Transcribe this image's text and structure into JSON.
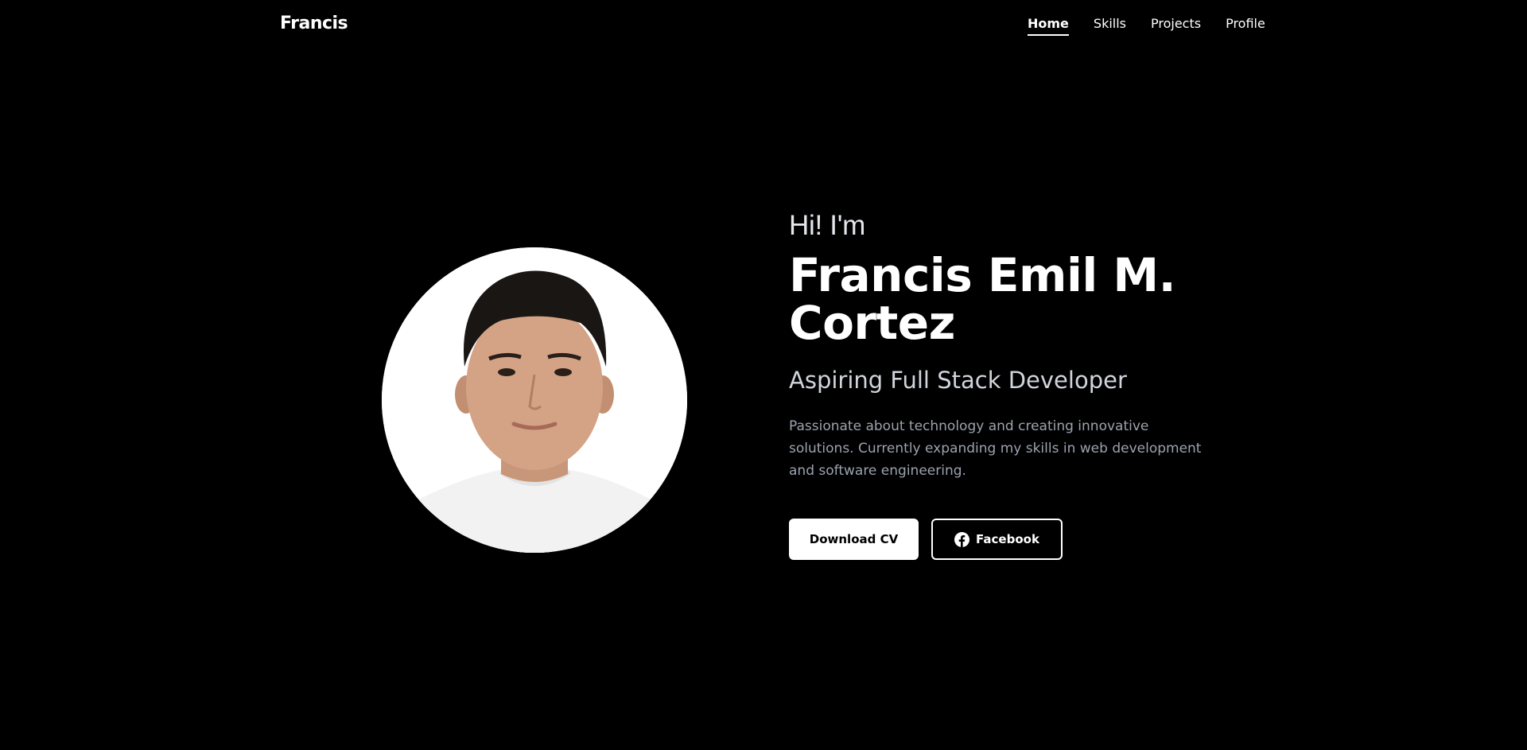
{
  "nav": {
    "brand": "Francis",
    "links": [
      {
        "label": "Home",
        "active": true
      },
      {
        "label": "Skills",
        "active": false
      },
      {
        "label": "Projects",
        "active": false
      },
      {
        "label": "Profile",
        "active": false
      }
    ]
  },
  "hero": {
    "greeting": "Hi! I'm",
    "name_line1": "Francis Emil M.",
    "name_line2": "Cortez",
    "role": "Aspiring Full Stack Developer",
    "bio": "Passionate about technology and creating innovative solutions. Currently expanding my skills in web development and software engineering.",
    "primary_button": "Download CV",
    "secondary_button": "Facebook",
    "secondary_button_icon": "facebook-icon"
  },
  "colors": {
    "background": "#000000",
    "text": "#ffffff",
    "muted_text": "#9ca3af"
  }
}
